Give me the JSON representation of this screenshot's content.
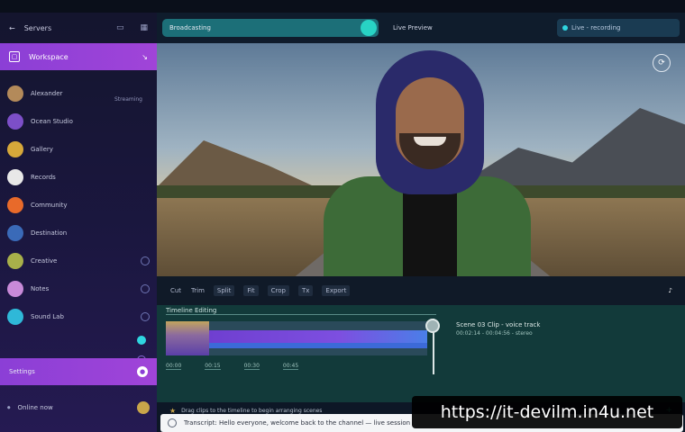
{
  "sidebar": {
    "header_label": "Servers",
    "active_item": "Workspace",
    "items": [
      {
        "label": "Alexander",
        "sub": "Streaming",
        "color": "#b38a5a",
        "dot": false
      },
      {
        "label": "Ocean Studio",
        "sub": "",
        "color": "#7d4fc8",
        "dot": false
      },
      {
        "label": "Gallery",
        "sub": "",
        "color": "#d6a83a",
        "dot": false
      },
      {
        "label": "Records",
        "sub": "",
        "color": "#e8e8e8",
        "dot": false
      },
      {
        "label": "Community",
        "sub": "",
        "color": "#e86a2a",
        "dot": false
      },
      {
        "label": "Destination",
        "sub": "",
        "color": "#3a6ab8",
        "dot": false
      },
      {
        "label": "Creative",
        "sub": "",
        "color": "#a8b04a",
        "dot": true
      },
      {
        "label": "Notes",
        "sub": "",
        "color": "#c88ad8",
        "dot": true
      },
      {
        "label": "Sound Lab",
        "sub": "",
        "color": "#2fb8d8",
        "dot": true
      }
    ],
    "settings_label": "Settings",
    "user_label": "Online now"
  },
  "topbar": {
    "search_text": "Broadcasting",
    "title": "Live Preview",
    "status_text": "Live - recording"
  },
  "toolbar": {
    "buttons": [
      "Cut",
      "Trim",
      "Split",
      "Fit",
      "Crop",
      "Tx",
      "Export"
    ]
  },
  "timeline": {
    "label": "Timeline Editing",
    "info_title": "Scene 03 Clip - voice track",
    "info_sub": "00:02:14 - 00:04:56 - stereo",
    "ticks": [
      "00:00",
      "00:15",
      "00:30",
      "00:45"
    ]
  },
  "bottom": {
    "text": "Drag clips to the timeline to begin arranging scenes"
  },
  "input": {
    "text": "Transcript: Hello everyone, welcome back to the channel — live session"
  },
  "watermark": "https://it-devilm.in4u.net",
  "colors": {
    "accent": "#8b3fd6",
    "teal": "#28d3c4",
    "timeline_bg": "#123a3a"
  }
}
